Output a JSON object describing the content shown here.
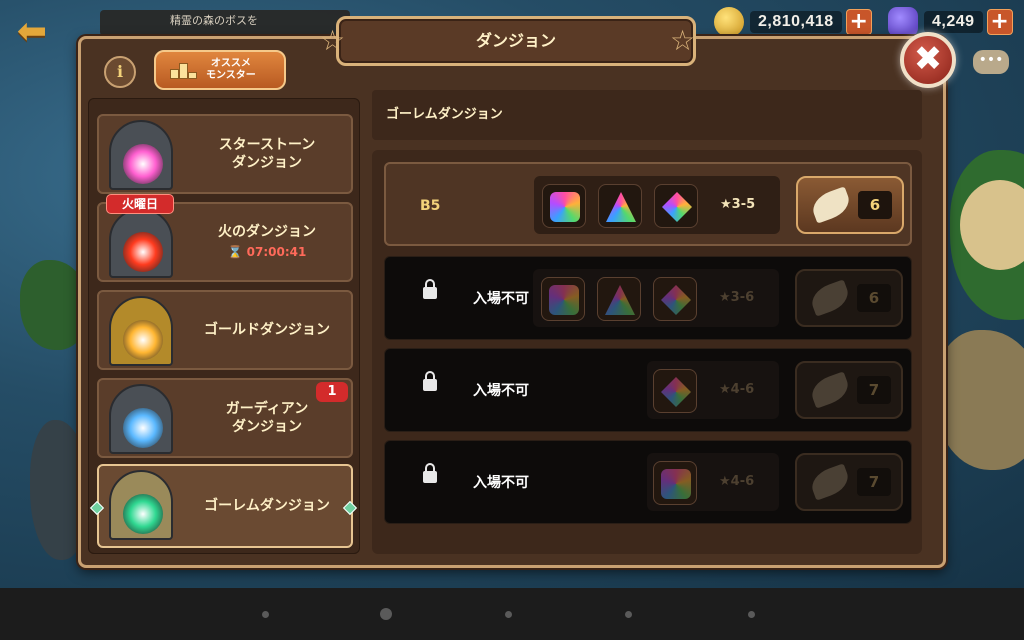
{
  "hud": {
    "quest_text": "精霊の森のボスを",
    "gold": "2,810,418",
    "gems": "4,249",
    "plus": "+"
  },
  "dialog": {
    "title": "ダンジョン",
    "info_label": "i",
    "close_label": "✖",
    "recommend_line1": "オススメ",
    "recommend_line2": "モンスター"
  },
  "dungeons": [
    {
      "name_line1": "スターストーン",
      "name_line2": "ダンジョン",
      "swirl": "#ff5fd0"
    },
    {
      "name_line1": "火のダンジョン",
      "name_line2": "",
      "day_badge": "火曜日",
      "timer": "07:00:41",
      "swirl": "#ff3b1f"
    },
    {
      "name_line1": "ゴールドダンジョン",
      "name_line2": "",
      "swirl": "#ffb632"
    },
    {
      "name_line1": "ガーディアン",
      "name_line2": "ダンジョン",
      "badge": "1",
      "swirl": "#5ab8ff"
    },
    {
      "name_line1": "ゴーレムダンジョン",
      "name_line2": "",
      "swirl": "#2fd891",
      "selected": true
    }
  ],
  "selected_dungeon": {
    "header": "ゴーレムダンジョン",
    "floors": [
      {
        "label": "B5",
        "locked": false,
        "stars": "★3-5",
        "cost": "6",
        "runes": [
          "square",
          "triangle",
          "diamond"
        ]
      },
      {
        "label": "入場不可",
        "locked": true,
        "stars": "★3-6",
        "cost": "6",
        "runes": [
          "square",
          "triangle",
          "diamond"
        ]
      },
      {
        "label": "入場不可",
        "locked": true,
        "stars": "★4-6",
        "cost": "7",
        "runes": [
          "diamond"
        ]
      },
      {
        "label": "入場不可",
        "locked": true,
        "stars": "★4-6",
        "cost": "7",
        "runes": [
          "square"
        ]
      }
    ]
  },
  "colors": {
    "panel_bg": "#4a3222",
    "frame": "#c9a172",
    "accent_gold": "#f3d27a",
    "badge_red": "#d32b2b"
  }
}
